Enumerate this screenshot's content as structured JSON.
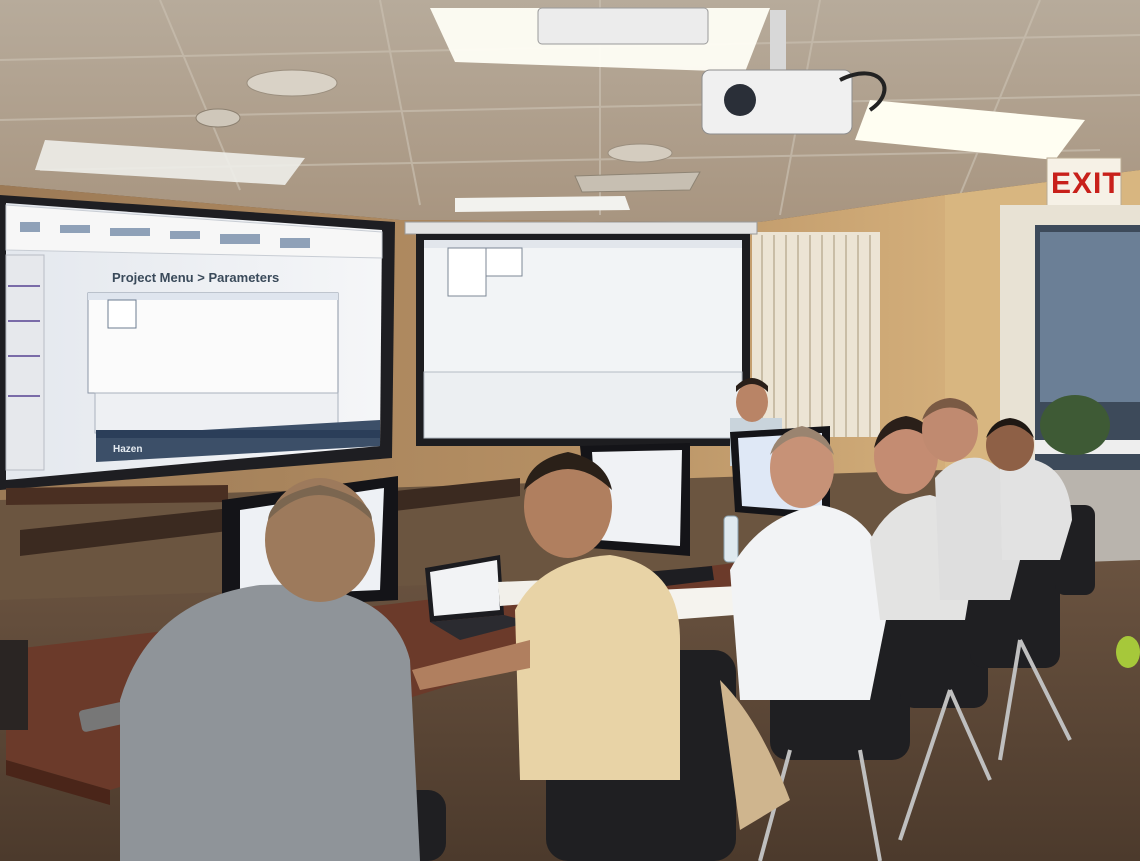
{
  "scene": {
    "description_type": "photo",
    "exit_sign": "EXIT",
    "left_screen": {
      "slide_title": "Project Menu > Parameters",
      "footer_brand": "Hazen"
    }
  },
  "colors": {
    "wall": "#c9a77c",
    "ceiling": "#b9ab97",
    "screen": "#f3f5f7",
    "carpet": "#5a4636",
    "exit_red": "#c8201a"
  }
}
